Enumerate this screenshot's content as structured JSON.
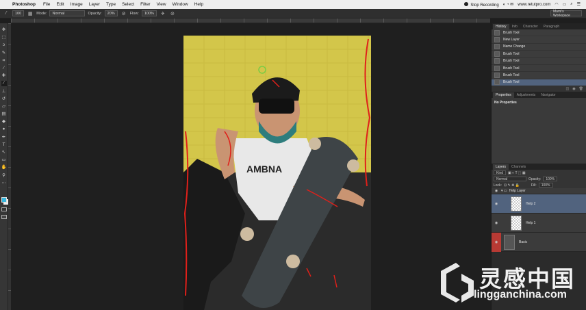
{
  "menubar": {
    "app_name": "Photoshop",
    "menus": [
      "File",
      "Edit",
      "Image",
      "Layer",
      "Type",
      "Select",
      "Filter",
      "View",
      "Window",
      "Help"
    ],
    "stop_recording": "Stop Recording",
    "url": "www.retutpro.com",
    "workspace": "Mami's Workspace"
  },
  "options_bar": {
    "brush_size": "100",
    "mode_label": "Mode:",
    "mode_value": "Normal",
    "opacity_label": "Opacity:",
    "opacity_value": "20%",
    "flow_label": "Flow:",
    "flow_value": "100%"
  },
  "history_panel": {
    "tabs": [
      "History",
      "Info",
      "Character",
      "Paragraph"
    ],
    "items": [
      {
        "label": "Brush Tool",
        "selected": false
      },
      {
        "label": "New Layer",
        "selected": false
      },
      {
        "label": "Name Change",
        "selected": false
      },
      {
        "label": "Brush Tool",
        "selected": false
      },
      {
        "label": "Brush Tool",
        "selected": false
      },
      {
        "label": "Brush Tool",
        "selected": false
      },
      {
        "label": "Brush Tool",
        "selected": false
      },
      {
        "label": "Brush Tool",
        "selected": true
      }
    ]
  },
  "properties_panel": {
    "tabs": [
      "Properties",
      "Adjustments",
      "Navigator"
    ],
    "message": "No Properties"
  },
  "layers_panel": {
    "tabs": [
      "Layers",
      "Channels"
    ],
    "kind_label": "Kind",
    "blend_mode": "Normal",
    "opacity_label": "Opacity:",
    "opacity_value": "100%",
    "lock_label": "Lock:",
    "fill_label": "Fill:",
    "fill_value": "100%",
    "group_name": "Help Layer",
    "layers": [
      {
        "name": "Help 2",
        "selected": true
      },
      {
        "name": "Help 1",
        "selected": false
      }
    ],
    "base_layer": "Basic"
  },
  "watermark": {
    "logo_text": "灵感中国",
    "url": "lingganchina.com"
  },
  "colors": {
    "foreground": "#36b6dd",
    "background": "#f0f0f0",
    "selection": "#51637e",
    "annotation_red": "#e0201a"
  }
}
